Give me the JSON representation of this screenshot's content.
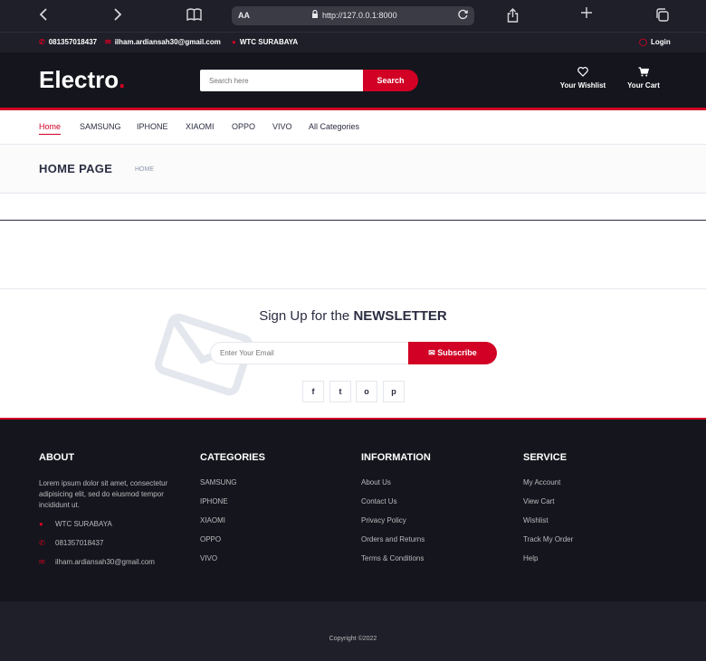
{
  "browser": {
    "url": "http://127.0.0.1:8000",
    "text_size_label": "AA",
    "icons": [
      "chevron-left-icon",
      "chevron-right-icon",
      "book-icon",
      "lock-icon",
      "reload-icon",
      "share-icon",
      "plus-icon",
      "tabs-icon"
    ]
  },
  "top_bar": {
    "phone": "081357018437",
    "email": "ilham.ardiansah30@gmail.com",
    "location": "WTC SURABAYA",
    "login": "Login"
  },
  "header": {
    "logo_text": "Electro",
    "logo_dot": ".",
    "search_placeholder": "Search here",
    "search_button": "Search",
    "wishlist_label": "Your Wishlist",
    "cart_label": "Your Cart"
  },
  "nav": {
    "items": [
      "Home",
      "SAMSUNG",
      "IPHONE",
      "XIAOMI",
      "OPPO",
      "VIVO",
      "All Categories"
    ],
    "active": "Home"
  },
  "breadcrumb": {
    "title": "HOME PAGE",
    "crumb": "HOME"
  },
  "newsletter": {
    "title_prefix": "Sign Up for the ",
    "title_bold": "NEWSLETTER",
    "email_placeholder": "Enter Your Email",
    "subscribe_button": "Subscribe",
    "social": [
      "f",
      "t",
      "o",
      "p"
    ]
  },
  "footer": {
    "about": {
      "heading": "ABOUT",
      "text": "Lorem ipsum dolor sit amet, consectetur adipisicing elit, sed do eiusmod tempor incididunt ut.",
      "location": "WTC SURABAYA",
      "phone": "081357018437",
      "email": "ilham.ardiansah30@gmail.com"
    },
    "categories": {
      "heading": "CATEGORIES",
      "items": [
        "SAMSUNG",
        "IPHONE",
        "XIAOMI",
        "OPPO",
        "VIVO"
      ]
    },
    "information": {
      "heading": "INFORMATION",
      "items": [
        "About Us",
        "Contact Us",
        "Privacy Policy",
        "Orders and Returns",
        "Terms & Conditions"
      ]
    },
    "service": {
      "heading": "SERVICE",
      "items": [
        "My Account",
        "View Cart",
        "Wishlist",
        "Track My Order",
        "Help"
      ]
    },
    "copyright": "Copyright ©2022"
  },
  "colors": {
    "accent": "#d10024",
    "dark": "#15161d",
    "darker_bar": "#1e1f29",
    "text": "#2b2d42"
  }
}
